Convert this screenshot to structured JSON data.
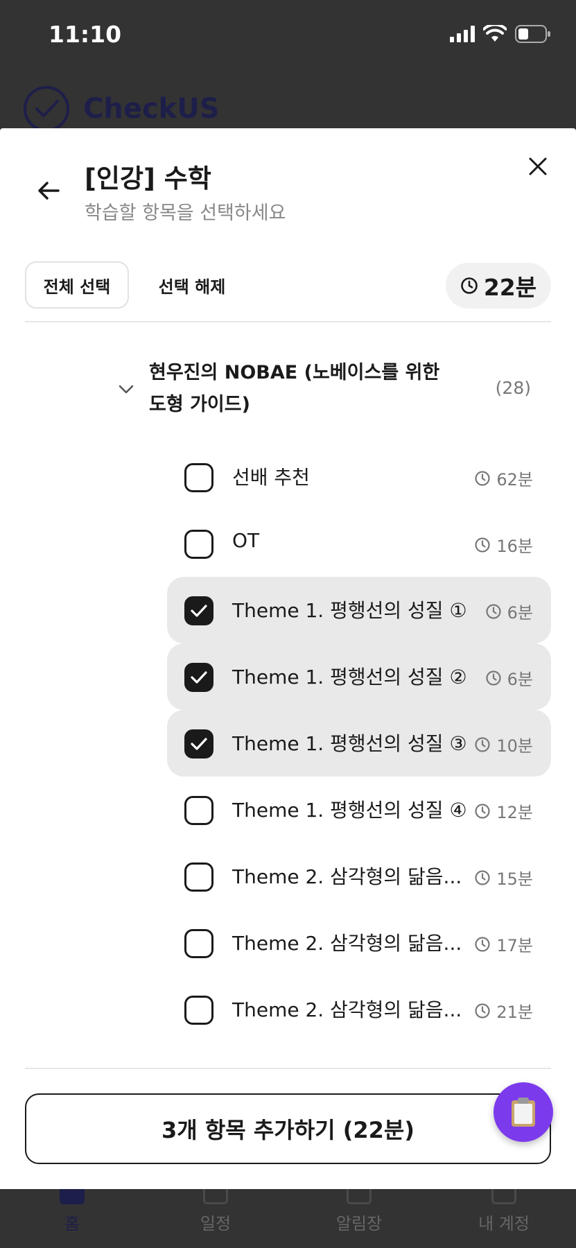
{
  "status_bar": {
    "time": "11:10"
  },
  "background_app": {
    "brand": "CheckUS"
  },
  "sheet": {
    "title": "[인강] 수학",
    "subtitle": "학습할 항목을 선택하세요",
    "select_all_label": "전체 선택",
    "deselect_label": "선택 해제",
    "total_duration": "22분"
  },
  "group": {
    "title": "현우진의 NOBAE (노베이스를 위한 도형 가이드)",
    "count": "(28)",
    "expanded": true
  },
  "items": [
    {
      "label": "선배 추천",
      "duration": "62분",
      "checked": false
    },
    {
      "label": "OT",
      "duration": "16분",
      "checked": false
    },
    {
      "label": "Theme 1. 평행선의 성질 ①",
      "duration": "6분",
      "checked": true
    },
    {
      "label": "Theme 1. 평행선의 성질 ②",
      "duration": "6분",
      "checked": true
    },
    {
      "label": "Theme 1. 평행선의 성질 ③",
      "duration": "10분",
      "checked": true
    },
    {
      "label": "Theme 1. 평행선의 성질 ④",
      "duration": "12분",
      "checked": false
    },
    {
      "label": "Theme 2. 삼각형의 닮음...",
      "duration": "15분",
      "checked": false
    },
    {
      "label": "Theme 2. 삼각형의 닮음...",
      "duration": "17분",
      "checked": false
    },
    {
      "label": "Theme 2. 삼각형의 닮음...",
      "duration": "21분",
      "checked": false
    }
  ],
  "add_button": {
    "label": "3개 항목 추가하기 (22분)"
  },
  "tabbar": {
    "tabs": [
      {
        "label": "홈",
        "active": true
      },
      {
        "label": "일정",
        "active": false
      },
      {
        "label": "알림장",
        "active": false
      },
      {
        "label": "내 계정",
        "active": false
      }
    ]
  },
  "colors": {
    "accent": "#7c3aed",
    "brand": "#1e1e4a",
    "checked_bg": "#e9e9e9"
  }
}
